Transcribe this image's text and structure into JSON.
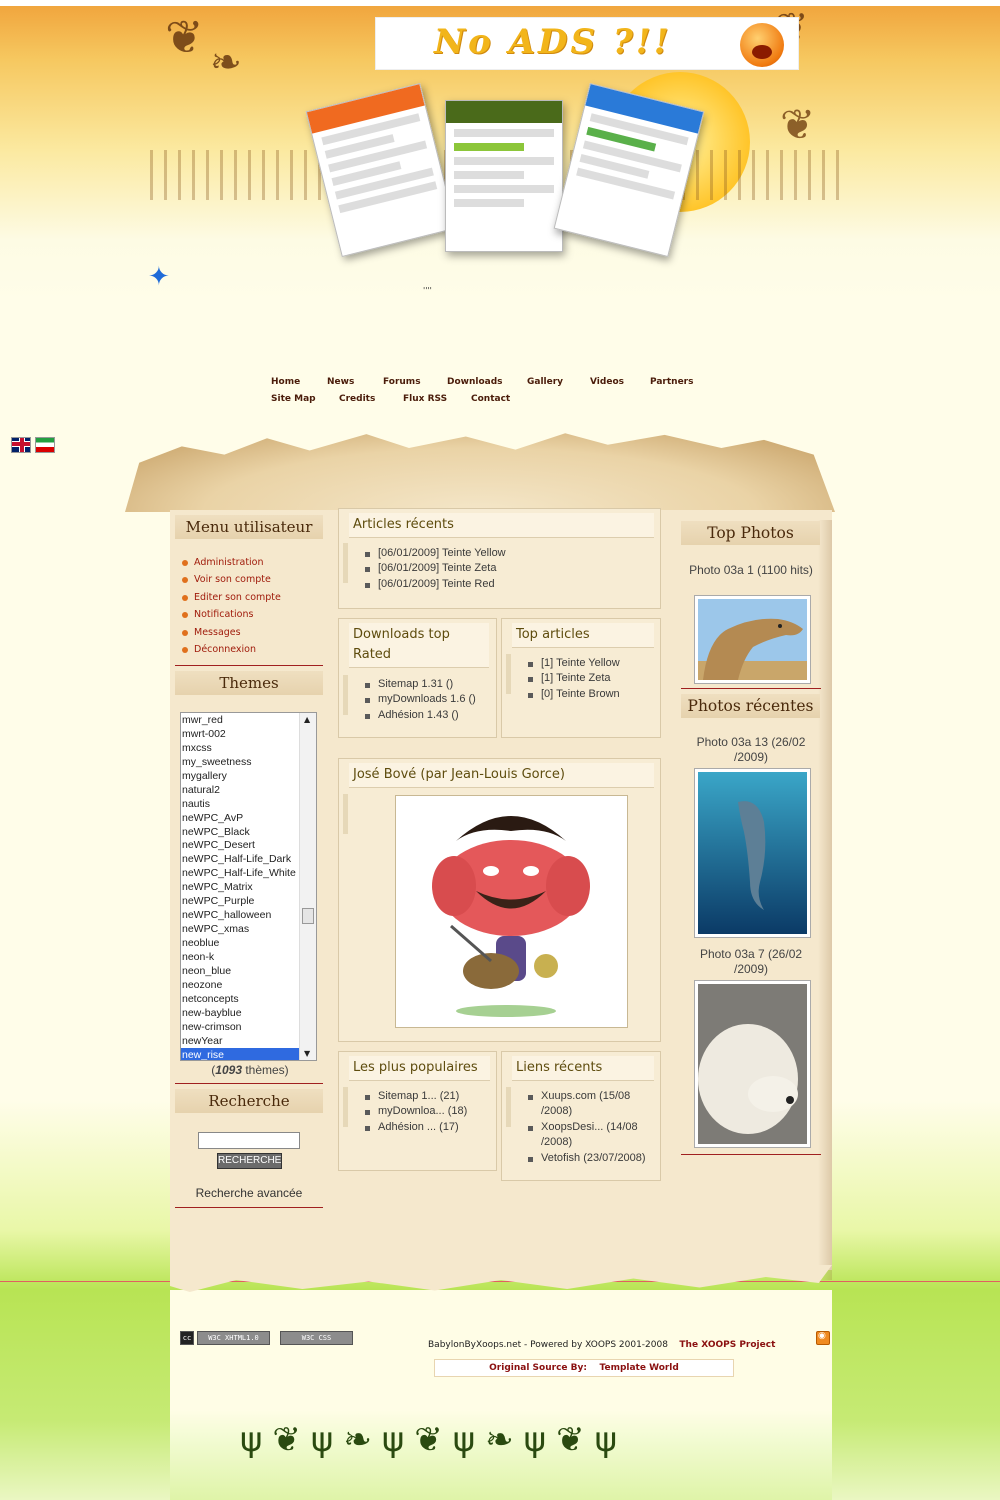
{
  "header": {
    "ad_text": "No ADS ?!!",
    "dots": "''''"
  },
  "nav": {
    "row1": [
      "Home",
      "News",
      "Forums",
      "Downloads",
      "Gallery",
      "Videos",
      "Partners"
    ],
    "row2": [
      "Site Map",
      "Credits",
      "Flux RSS",
      "Contact"
    ]
  },
  "language_flags": [
    "uk-flag-icon",
    "iran-flag-icon"
  ],
  "user_menu": {
    "title": "Menu utilisateur",
    "items": [
      "Administration",
      "Voir son compte",
      "Editer son compte",
      "Notifications",
      "Messages",
      "Déconnexion"
    ]
  },
  "themes": {
    "title": "Themes",
    "options": [
      "mwr_red",
      "mwrt-002",
      "mxcss",
      "my_sweetness",
      "mygallery",
      "natural2",
      "nautis",
      "neWPC_AvP",
      "neWPC_Black",
      "neWPC_Desert",
      "neWPC_Half-Life_Dark",
      "neWPC_Half-Life_White",
      "neWPC_Matrix",
      "neWPC_Purple",
      "neWPC_halloween",
      "neWPC_xmas",
      "neoblue",
      "neon-k",
      "neon_blue",
      "neozone",
      "netconcepts",
      "new-bayblue",
      "new-crimson",
      "newYear",
      "new_rise"
    ],
    "selected": "new_rise",
    "count_open": "(",
    "count": "1093",
    "count_suffix": " thèmes)"
  },
  "search": {
    "title": "Recherche",
    "button": "RECHERCHE",
    "advanced": "Recherche avancée"
  },
  "recent_articles": {
    "title": "Articles récents",
    "items": [
      "[06/01/2009] Teinte Yellow",
      "[06/01/2009] Teinte Zeta",
      "[06/01/2009] Teinte Red"
    ]
  },
  "downloads_top": {
    "title": "Downloads top Rated",
    "items": [
      "Sitemap 1.31 ()",
      "myDownloads 1.6 ()",
      "Adhésion 1.43 ()"
    ]
  },
  "top_articles": {
    "title": "Top articles",
    "items": [
      "[1] Teinte Yellow",
      "[1] Teinte Zeta",
      "[0] Teinte Brown"
    ]
  },
  "feature": {
    "title": "José Bové (par Jean-Louis Gorce)"
  },
  "popular": {
    "title": "Les plus populaires",
    "items": [
      "Sitemap 1... (21)",
      "myDownloa... (18)",
      "Adhésion ... (17)"
    ]
  },
  "recent_links": {
    "title": "Liens récents",
    "items": [
      "Xuups.com (15/08 /2008)",
      "XoopsDesi... (14/08 /2008)",
      "Vetofish (23/07/2008)"
    ]
  },
  "top_photos": {
    "title": "Top Photos",
    "caption": "Photo 03a 1 (1100 hits)"
  },
  "recent_photos": {
    "title": "Photos récentes",
    "captions": [
      "Photo 03a 13 (26/02 /2009)",
      "Photo 03a 7 (26/02 /2009)"
    ]
  },
  "footer": {
    "badge_xhtml": "W3C XHTML1.0",
    "badge_css": "W3C CSS",
    "powered": "BabylonByXoops.net - Powered by XOOPS 2001-2008",
    "project": "The XOOPS Project",
    "orig_label": "Original Source By:",
    "orig_name": "Template World"
  },
  "colors": {
    "menu_link": "#a01c0c",
    "block_title": "#5e4c0e",
    "selected_option": "#2f6ae0"
  }
}
